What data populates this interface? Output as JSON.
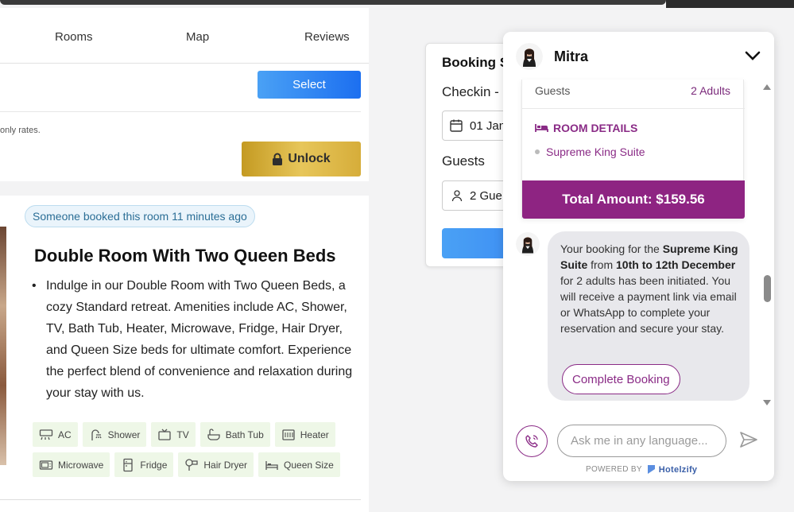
{
  "nav": {
    "rooms": "Rooms",
    "map": "Map",
    "reviews": "Reviews"
  },
  "rate": {
    "select_label": "Select",
    "rates_text": "only rates.",
    "unlock_label": "Unlock"
  },
  "room": {
    "booked_badge": "Someone booked this room 11 minutes ago",
    "title": "Double Room With Two Queen Beds",
    "description": "Indulge in our Double Room with Two Queen Beds, a cozy Standard retreat. Amenities include AC, Shower, TV, Bath Tub, Heater, Microwave, Fridge, Hair Dryer, and Queen Size beds for ultimate comfort. Experience the perfect blend of convenience and relaxation during your stay with us.",
    "amenities": [
      "AC",
      "Shower",
      "TV",
      "Bath Tub",
      "Heater",
      "Microwave",
      "Fridge",
      "Hair Dryer",
      "Queen Size"
    ]
  },
  "booking": {
    "title": "Booking S",
    "checkin_label": "Checkin - C",
    "date_value": "01 Jan",
    "guests_label": "Guests",
    "guests_value": "2 Gue"
  },
  "chat": {
    "agent_name": "Mitra",
    "summary": {
      "guests_label": "Guests",
      "guests_value": "2 Adults",
      "room_details_heading": "ROOM DETAILS",
      "room_name": "Supreme King Suite",
      "total": "Total Amount: $159.56"
    },
    "message": {
      "p1": "Your booking for the ",
      "b1": "Supreme King Suite",
      "p2": " from ",
      "b2": "10th to 12th December",
      "p3": " for 2 adults has been initiated. You will receive a payment link via email or WhatsApp to complete your reservation and secure your stay."
    },
    "complete_booking_label": "Complete Booking",
    "input_placeholder": "Ask me in any language...",
    "powered_by": "POWERED BY",
    "brand": "Hotelzify"
  },
  "colors": {
    "brand_purple": "#8e2482",
    "primary_blue": "#1c6ff0",
    "gold": "#d6ad3a",
    "amenity_bg": "#eef7e7"
  }
}
